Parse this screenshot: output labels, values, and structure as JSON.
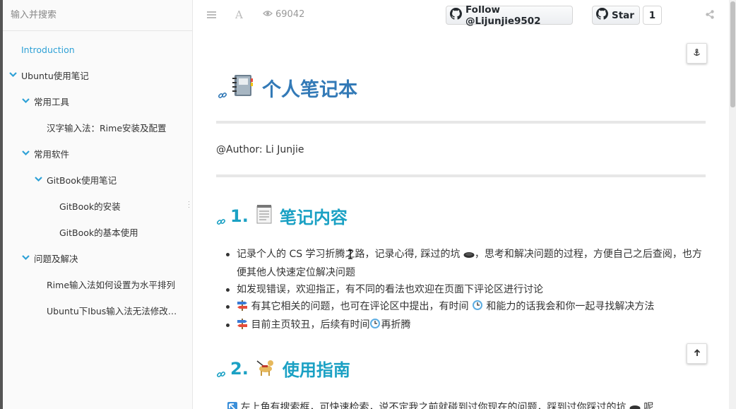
{
  "search": {
    "placeholder": "输入并搜索"
  },
  "sidebar": {
    "items": [
      {
        "label": "Introduction"
      },
      {
        "label": "Ubuntu使用笔记"
      },
      {
        "label": "常用工具"
      },
      {
        "label": "汉字输入法：Rime安装及配置"
      },
      {
        "label": "常用软件"
      },
      {
        "label": "GitBook使用笔记"
      },
      {
        "label": "GitBook的安装"
      },
      {
        "label": "GitBook的基本使用"
      },
      {
        "label": "问题及解决"
      },
      {
        "label": "Rime输入法如何设置为水平排列"
      },
      {
        "label": "Ubuntu下Ibus输入法无法修改…"
      }
    ]
  },
  "toolbar": {
    "views": "69042",
    "follow_label": "Follow @Lijunjie9502",
    "star_label": "Star",
    "star_count": "1"
  },
  "page": {
    "title": "个人笔记本",
    "author": "@Author: Li Junjie",
    "section1": {
      "number": "1.",
      "title": "笔记内容"
    },
    "section2": {
      "number": "2.",
      "title": "使用指南"
    },
    "notes": [
      {
        "text_a": "记录个人的 CS 学习折腾之路，记录心得, 踩过的坑 ",
        "text_b": "，思考和解决问题的过程，方便自己之后查阅，也方便其他人快速定位解决问题"
      },
      {
        "text_a": "如发现错误，欢迎指正，有不同的看法也欢迎在页面下评论区进行讨论"
      },
      {
        "text_a": " 有其它相关的问题，也可在评论区中提出，有时间 ",
        "text_b": " 和能力的话我会和你一起寻找解决方法"
      },
      {
        "text_a": " 目前主页较丑，后续有时间",
        "text_b": "再折腾"
      }
    ],
    "guide_line": {
      "text_a": " 左上角有搜索框，可快速检索，说不定我之前就碰到过你现在的问题，踩到过你踩过的坑 ",
      "text_b": " 呢"
    }
  },
  "colors": {
    "accent": "#2fa1d6",
    "title": "#337ab7",
    "heading": "#1ba1c4"
  },
  "icons": [
    "list-icon",
    "font-icon",
    "eye-icon",
    "github-icon",
    "share-icon",
    "anchor-icon",
    "arrow-up-icon",
    "link-icon",
    "notebook-emoji",
    "notepad-emoji",
    "guide-dog-emoji",
    "hole-emoji",
    "clock-emoji",
    "signpost-emoji",
    "arrow-upper-left-emoji"
  ]
}
